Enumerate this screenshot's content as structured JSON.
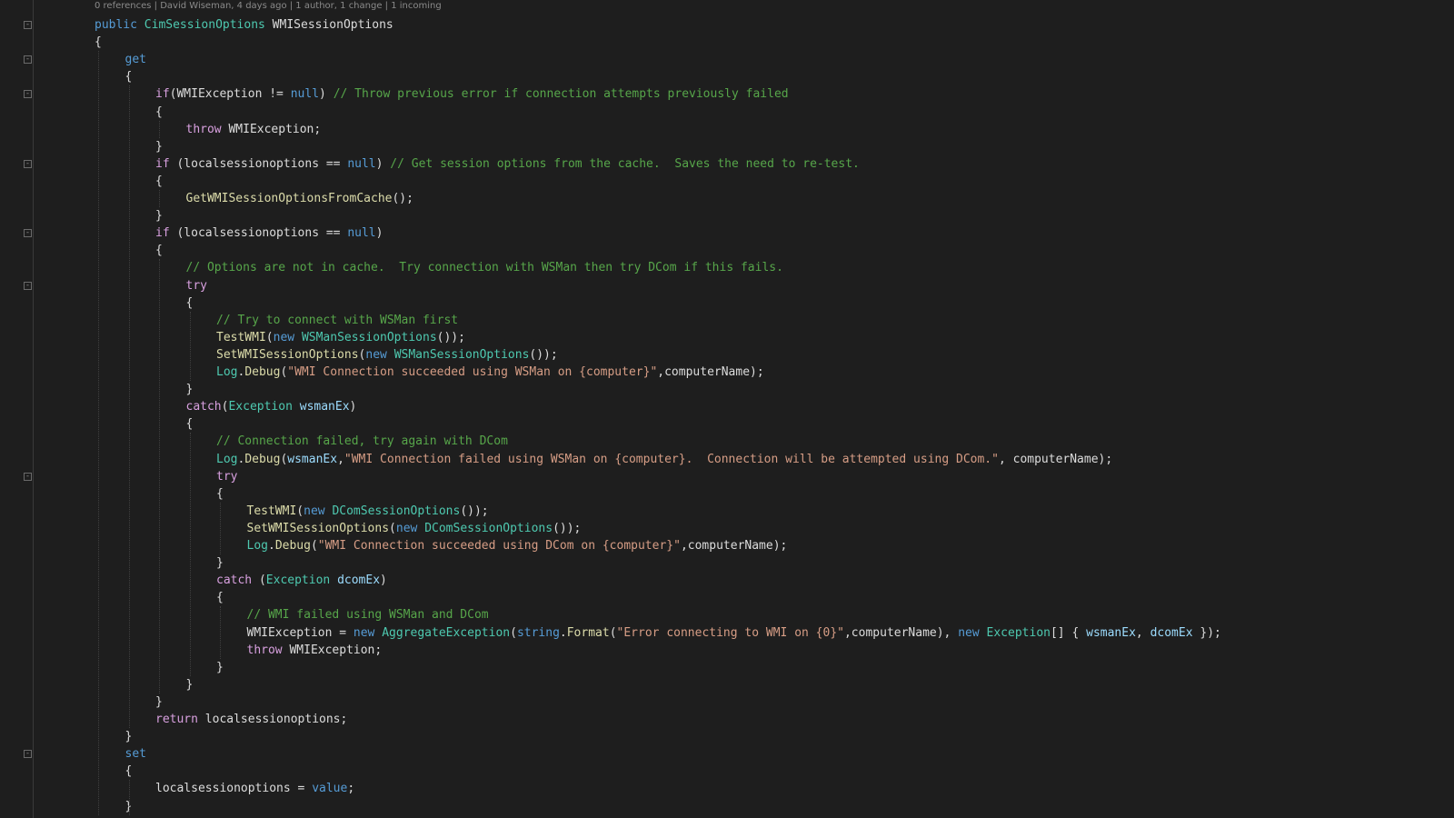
{
  "editor": {
    "codelens": "0 references | David Wiseman, 4 days ago | 1 author, 1 change | 1 incoming",
    "lines": [
      [
        {
          "t": "public ",
          "c": "kw"
        },
        {
          "t": "CimSessionOptions",
          "c": "typ"
        },
        {
          "t": " WMISessionOptions",
          "c": "plain"
        }
      ],
      [
        {
          "t": "{",
          "c": "plain"
        }
      ],
      [
        {
          "t": "get",
          "c": "kw"
        }
      ],
      [
        {
          "t": "{",
          "c": "plain"
        }
      ],
      [
        {
          "t": "if",
          "c": "ctl"
        },
        {
          "t": "(WMIException != ",
          "c": "plain"
        },
        {
          "t": "null",
          "c": "kw"
        },
        {
          "t": ") ",
          "c": "plain"
        },
        {
          "t": "// Throw previous error if connection attempts previously failed",
          "c": "cm"
        }
      ],
      [
        {
          "t": "{",
          "c": "plain"
        }
      ],
      [
        {
          "t": "throw",
          "c": "ctl"
        },
        {
          "t": " WMIException;",
          "c": "plain"
        }
      ],
      [
        {
          "t": "}",
          "c": "plain"
        }
      ],
      [
        {
          "t": "if",
          "c": "ctl"
        },
        {
          "t": " (localsessionoptions == ",
          "c": "plain"
        },
        {
          "t": "null",
          "c": "kw"
        },
        {
          "t": ") ",
          "c": "plain"
        },
        {
          "t": "// Get session options from the cache.  Saves the need to re-test.",
          "c": "cm"
        }
      ],
      [
        {
          "t": "{",
          "c": "plain"
        }
      ],
      [
        {
          "t": "GetWMISessionOptionsFromCache",
          "c": "fn"
        },
        {
          "t": "();",
          "c": "plain"
        }
      ],
      [
        {
          "t": "}",
          "c": "plain"
        }
      ],
      [
        {
          "t": "if",
          "c": "ctl"
        },
        {
          "t": " (localsessionoptions == ",
          "c": "plain"
        },
        {
          "t": "null",
          "c": "kw"
        },
        {
          "t": ")",
          "c": "plain"
        }
      ],
      [
        {
          "t": "{",
          "c": "plain"
        }
      ],
      [
        {
          "t": "// Options are not in cache.  Try connection with WSMan then try DCom if this fails.",
          "c": "cm"
        }
      ],
      [
        {
          "t": "try",
          "c": "ctl"
        }
      ],
      [
        {
          "t": "{",
          "c": "plain"
        }
      ],
      [
        {
          "t": "// Try to connect with WSMan first",
          "c": "cm"
        }
      ],
      [
        {
          "t": "TestWMI",
          "c": "fn"
        },
        {
          "t": "(",
          "c": "plain"
        },
        {
          "t": "new ",
          "c": "kw"
        },
        {
          "t": "WSManSessionOptions",
          "c": "typ"
        },
        {
          "t": "());",
          "c": "plain"
        }
      ],
      [
        {
          "t": "SetWMISessionOptions",
          "c": "fn"
        },
        {
          "t": "(",
          "c": "plain"
        },
        {
          "t": "new ",
          "c": "kw"
        },
        {
          "t": "WSManSessionOptions",
          "c": "typ"
        },
        {
          "t": "());",
          "c": "plain"
        }
      ],
      [
        {
          "t": "Log",
          "c": "typ"
        },
        {
          "t": ".",
          "c": "plain"
        },
        {
          "t": "Debug",
          "c": "fn"
        },
        {
          "t": "(",
          "c": "plain"
        },
        {
          "t": "\"WMI Connection succeeded using WSMan on {computer}\"",
          "c": "str"
        },
        {
          "t": ",computerName);",
          "c": "plain"
        }
      ],
      [
        {
          "t": "}",
          "c": "plain"
        }
      ],
      [
        {
          "t": "catch",
          "c": "ctl"
        },
        {
          "t": "(",
          "c": "plain"
        },
        {
          "t": "Exception ",
          "c": "typ"
        },
        {
          "t": "wsmanEx",
          "c": "var"
        },
        {
          "t": ")",
          "c": "plain"
        }
      ],
      [
        {
          "t": "{",
          "c": "plain"
        }
      ],
      [
        {
          "t": "// Connection failed, try again with DCom",
          "c": "cm"
        }
      ],
      [
        {
          "t": "Log",
          "c": "typ"
        },
        {
          "t": ".",
          "c": "plain"
        },
        {
          "t": "Debug",
          "c": "fn"
        },
        {
          "t": "(",
          "c": "plain"
        },
        {
          "t": "wsmanEx",
          "c": "var"
        },
        {
          "t": ",",
          "c": "plain"
        },
        {
          "t": "\"WMI Connection failed using WSMan on {computer}.  Connection will be attempted using DCom.\"",
          "c": "str"
        },
        {
          "t": ", computerName);",
          "c": "plain"
        }
      ],
      [
        {
          "t": "try",
          "c": "ctl"
        }
      ],
      [
        {
          "t": "{",
          "c": "plain"
        }
      ],
      [
        {
          "t": "TestWMI",
          "c": "fn"
        },
        {
          "t": "(",
          "c": "plain"
        },
        {
          "t": "new ",
          "c": "kw"
        },
        {
          "t": "DComSessionOptions",
          "c": "typ"
        },
        {
          "t": "());",
          "c": "plain"
        }
      ],
      [
        {
          "t": "SetWMISessionOptions",
          "c": "fn"
        },
        {
          "t": "(",
          "c": "plain"
        },
        {
          "t": "new ",
          "c": "kw"
        },
        {
          "t": "DComSessionOptions",
          "c": "typ"
        },
        {
          "t": "());",
          "c": "plain"
        }
      ],
      [
        {
          "t": "Log",
          "c": "typ"
        },
        {
          "t": ".",
          "c": "plain"
        },
        {
          "t": "Debug",
          "c": "fn"
        },
        {
          "t": "(",
          "c": "plain"
        },
        {
          "t": "\"WMI Connection succeeded using DCom on {computer}\"",
          "c": "str"
        },
        {
          "t": ",computerName);",
          "c": "plain"
        }
      ],
      [
        {
          "t": "}",
          "c": "plain"
        }
      ],
      [
        {
          "t": "catch",
          "c": "ctl"
        },
        {
          "t": " (",
          "c": "plain"
        },
        {
          "t": "Exception ",
          "c": "typ"
        },
        {
          "t": "dcomEx",
          "c": "var"
        },
        {
          "t": ")",
          "c": "plain"
        }
      ],
      [
        {
          "t": "{",
          "c": "plain"
        }
      ],
      [
        {
          "t": "// WMI failed using WSMan and DCom",
          "c": "cm"
        }
      ],
      [
        {
          "t": "WMIException = ",
          "c": "plain"
        },
        {
          "t": "new ",
          "c": "kw"
        },
        {
          "t": "AggregateException",
          "c": "typ"
        },
        {
          "t": "(",
          "c": "plain"
        },
        {
          "t": "string",
          "c": "kw"
        },
        {
          "t": ".",
          "c": "plain"
        },
        {
          "t": "Format",
          "c": "fn"
        },
        {
          "t": "(",
          "c": "plain"
        },
        {
          "t": "\"Error connecting to WMI on {0}\"",
          "c": "str"
        },
        {
          "t": ",computerName), ",
          "c": "plain"
        },
        {
          "t": "new ",
          "c": "kw"
        },
        {
          "t": "Exception",
          "c": "typ"
        },
        {
          "t": "[] { ",
          "c": "plain"
        },
        {
          "t": "wsmanEx",
          "c": "var"
        },
        {
          "t": ", ",
          "c": "plain"
        },
        {
          "t": "dcomEx",
          "c": "var"
        },
        {
          "t": " });",
          "c": "plain"
        }
      ],
      [
        {
          "t": "throw",
          "c": "ctl"
        },
        {
          "t": " WMIException;",
          "c": "plain"
        }
      ],
      [
        {
          "t": "}",
          "c": "plain"
        }
      ],
      [
        {
          "t": "}",
          "c": "plain"
        }
      ],
      [
        {
          "t": "}",
          "c": "plain"
        }
      ],
      [
        {
          "t": "return",
          "c": "ctl"
        },
        {
          "t": " localsessionoptions;",
          "c": "plain"
        }
      ],
      [
        {
          "t": "}",
          "c": "plain"
        }
      ],
      [
        {
          "t": "set",
          "c": "kw"
        }
      ],
      [
        {
          "t": "{",
          "c": "plain"
        }
      ],
      [
        {
          "t": "localsessionoptions = ",
          "c": "plain"
        },
        {
          "t": "value",
          "c": "kw"
        },
        {
          "t": ";",
          "c": "plain"
        }
      ],
      [
        {
          "t": "}",
          "c": "plain"
        }
      ]
    ]
  },
  "colors": {
    "background": "#1e1e1e",
    "keyword": "#569cd6",
    "control": "#d8a0df",
    "type": "#4ec9b0",
    "comment": "#57a64a",
    "string": "#d69d85",
    "method": "#dcdcaa",
    "variable": "#9cdcfe",
    "plain": "#dcdcdc"
  }
}
